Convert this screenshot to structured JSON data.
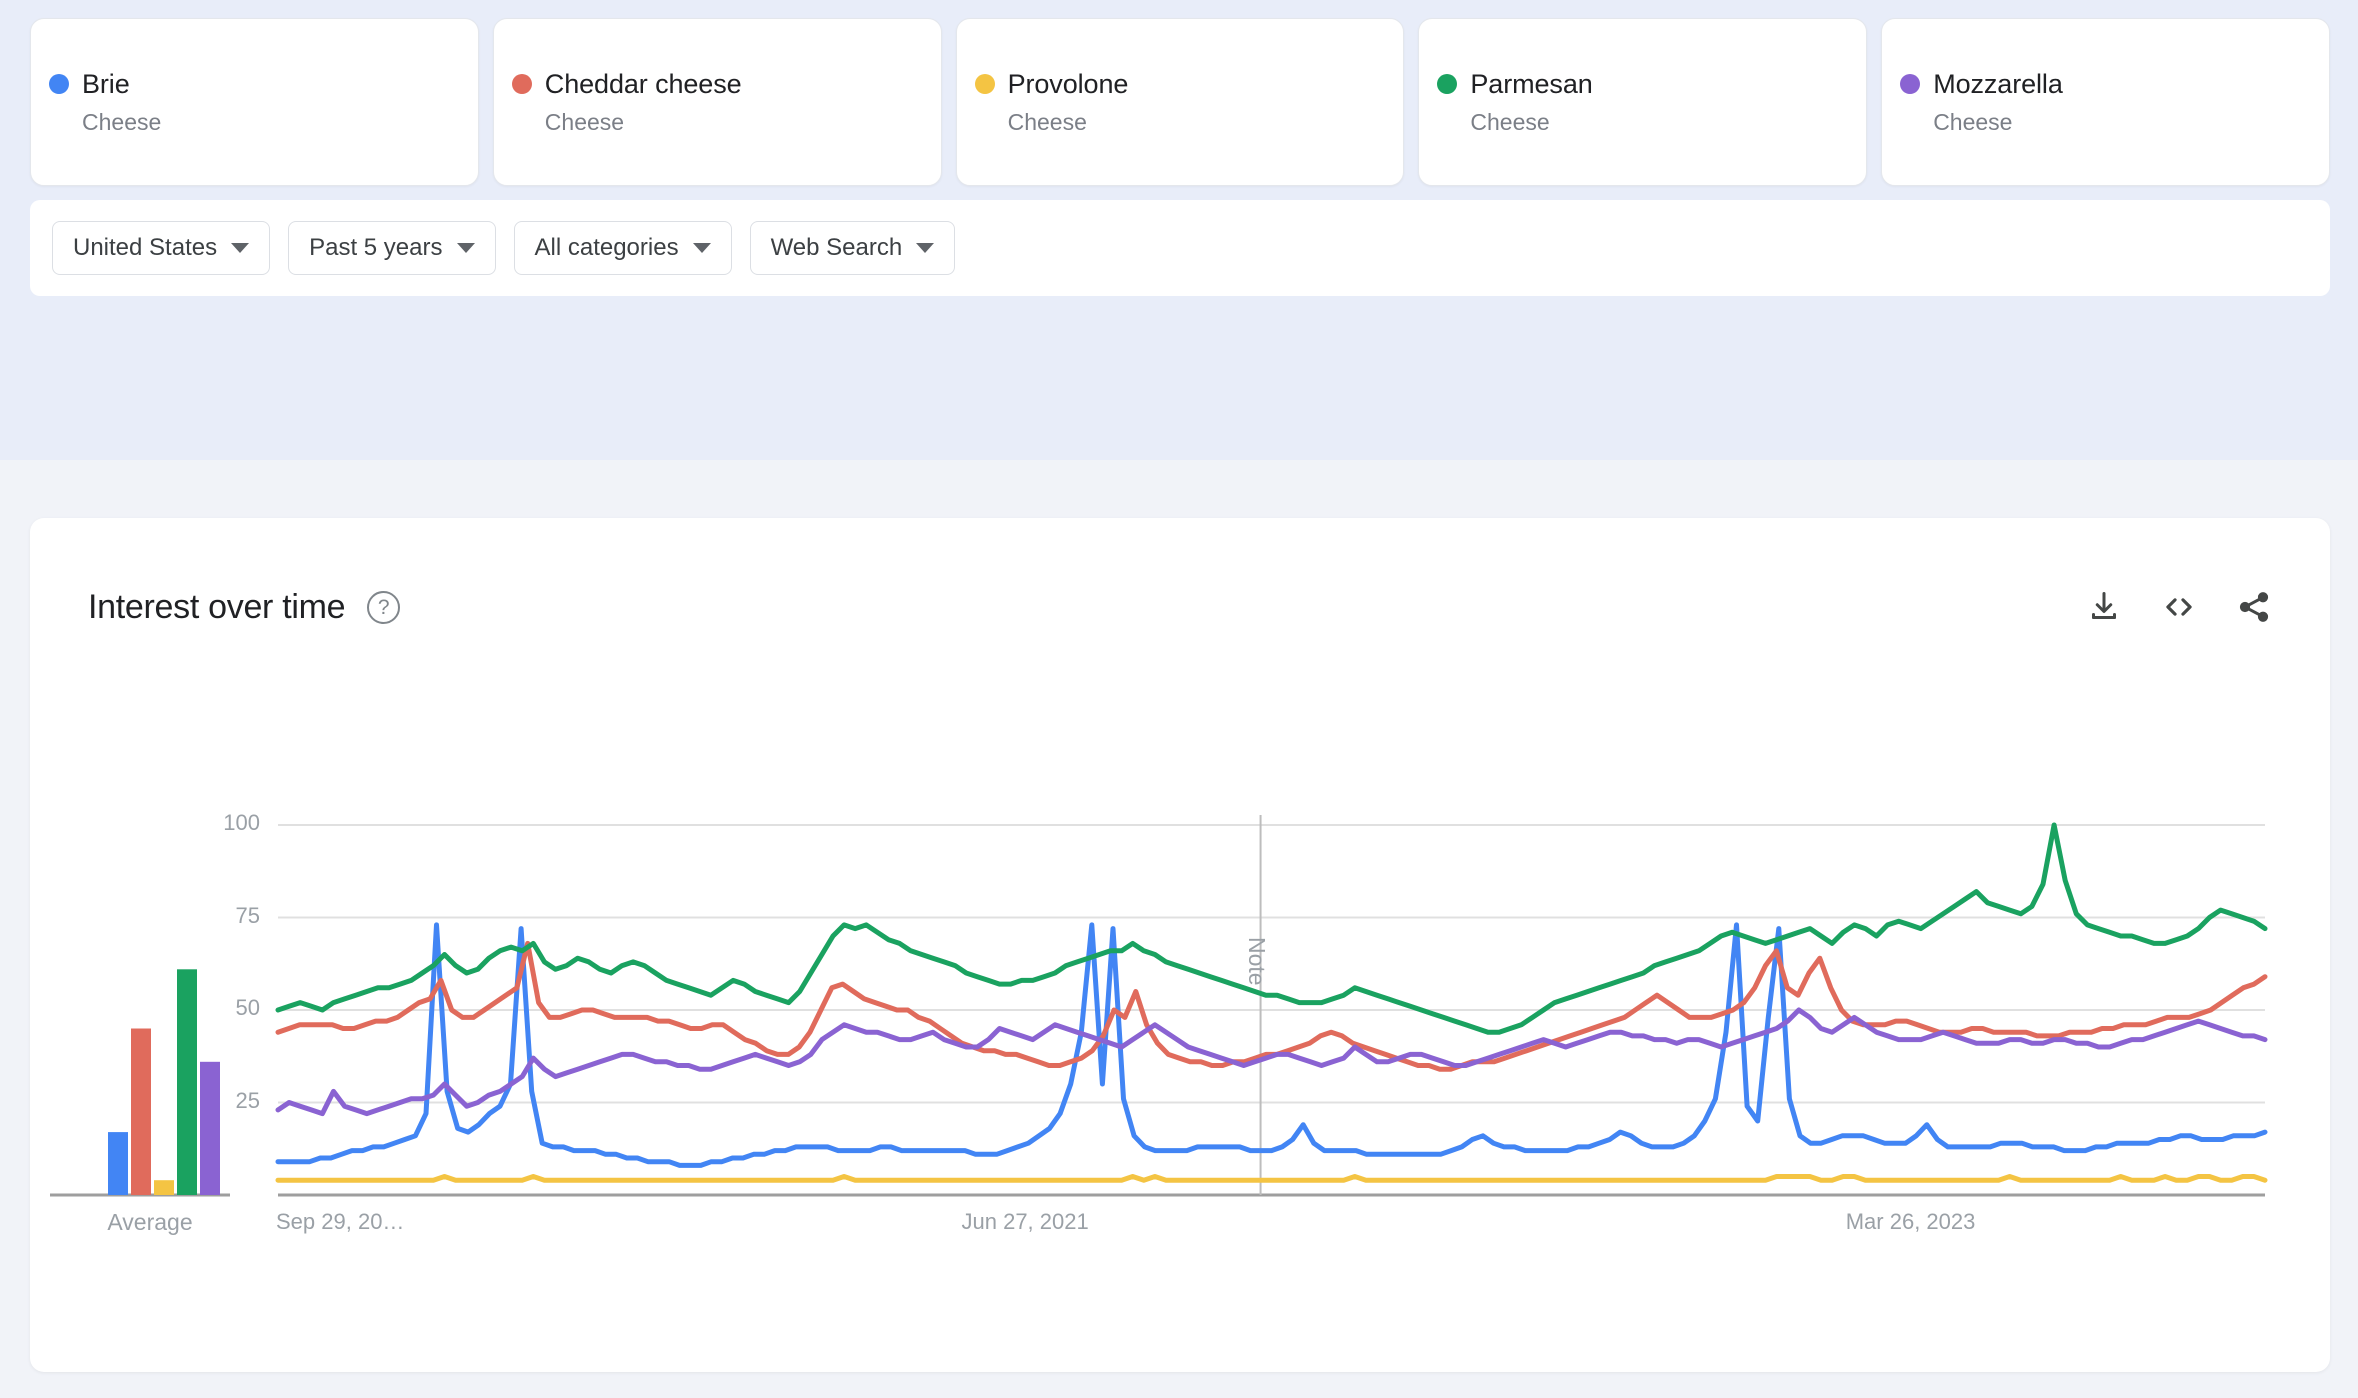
{
  "terms": [
    {
      "name": "Brie",
      "subtitle": "Cheese",
      "color": "#4285f4"
    },
    {
      "name": "Cheddar cheese",
      "subtitle": "Cheese",
      "color": "#e06b5c"
    },
    {
      "name": "Provolone",
      "subtitle": "Cheese",
      "color": "#f4c443"
    },
    {
      "name": "Parmesan",
      "subtitle": "Cheese",
      "color": "#1aa260"
    },
    {
      "name": "Mozzarella",
      "subtitle": "Cheese",
      "color": "#8a63d2"
    }
  ],
  "filters": [
    {
      "label": "United States",
      "icon": "chevron-down-icon"
    },
    {
      "label": "Past 5 years",
      "icon": "chevron-down-icon"
    },
    {
      "label": "All categories",
      "icon": "chevron-down-icon"
    },
    {
      "label": "Web Search",
      "icon": "chevron-down-icon"
    }
  ],
  "chart_card": {
    "title": "Interest over time",
    "help_icon": "help-circle-icon",
    "actions": [
      {
        "name": "download-icon"
      },
      {
        "name": "embed-code-icon"
      },
      {
        "name": "share-icon"
      }
    ]
  },
  "chart_data": {
    "type": "line",
    "title": "Interest over time",
    "xlabel": "",
    "ylabel": "",
    "ylim": [
      0,
      100
    ],
    "yticks": [
      25,
      50,
      75,
      100
    ],
    "grid": true,
    "legend_position": "top-cards",
    "x_tick_labels": [
      "Sep 29, 20…",
      "Jun 27, 2021",
      "Mar 26, 2023"
    ],
    "x_tick_positions": [
      0.0,
      0.345,
      0.79
    ],
    "annotations": [
      {
        "text": "Note",
        "type": "vertical-marker",
        "x_fraction": 0.4945
      }
    ],
    "average_bars": {
      "label": "Average",
      "categories": [
        "Brie",
        "Cheddar cheese",
        "Provolone",
        "Parmesan",
        "Mozzarella"
      ],
      "values": [
        17,
        45,
        4,
        61,
        36
      ]
    },
    "series": [
      {
        "name": "Brie",
        "color": "#4285f4",
        "values": [
          9,
          9,
          9,
          9,
          10,
          10,
          11,
          12,
          12,
          13,
          13,
          14,
          15,
          16,
          22,
          73,
          28,
          18,
          17,
          19,
          22,
          24,
          30,
          72,
          28,
          14,
          13,
          13,
          12,
          12,
          12,
          11,
          11,
          10,
          10,
          9,
          9,
          9,
          8,
          8,
          8,
          9,
          9,
          10,
          10,
          11,
          11,
          12,
          12,
          13,
          13,
          13,
          13,
          12,
          12,
          12,
          12,
          13,
          13,
          12,
          12,
          12,
          12,
          12,
          12,
          12,
          11,
          11,
          11,
          12,
          13,
          14,
          16,
          18,
          22,
          30,
          44,
          73,
          30,
          72,
          26,
          16,
          13,
          12,
          12,
          12,
          12,
          13,
          13,
          13,
          13,
          13,
          12,
          12,
          12,
          13,
          15,
          19,
          14,
          12,
          12,
          12,
          12,
          11,
          11,
          11,
          11,
          11,
          11,
          11,
          11,
          12,
          13,
          15,
          16,
          14,
          13,
          13,
          12,
          12,
          12,
          12,
          12,
          13,
          13,
          14,
          15,
          17,
          16,
          14,
          13,
          13,
          13,
          14,
          16,
          20,
          26,
          44,
          73,
          24,
          20,
          48,
          72,
          26,
          16,
          14,
          14,
          15,
          16,
          16,
          16,
          15,
          14,
          14,
          14,
          16,
          19,
          15,
          13,
          13,
          13,
          13,
          13,
          14,
          14,
          14,
          13,
          13,
          13,
          12,
          12,
          12,
          13,
          13,
          14,
          14,
          14,
          14,
          15,
          15,
          16,
          16,
          15,
          15,
          15,
          16,
          16,
          16,
          17
        ]
      },
      {
        "name": "Cheddar cheese",
        "color": "#e06b5c",
        "values": [
          44,
          45,
          46,
          46,
          46,
          46,
          45,
          45,
          46,
          47,
          47,
          48,
          50,
          52,
          53,
          58,
          50,
          48,
          48,
          50,
          52,
          54,
          56,
          68,
          52,
          48,
          48,
          49,
          50,
          50,
          49,
          48,
          48,
          48,
          48,
          47,
          47,
          46,
          45,
          45,
          46,
          46,
          44,
          42,
          41,
          39,
          38,
          38,
          40,
          44,
          50,
          56,
          57,
          55,
          53,
          52,
          51,
          50,
          50,
          48,
          47,
          45,
          43,
          41,
          40,
          39,
          39,
          38,
          38,
          37,
          36,
          35,
          35,
          36,
          37,
          39,
          43,
          50,
          48,
          55,
          46,
          41,
          38,
          37,
          36,
          36,
          35,
          35,
          36,
          36,
          37,
          38,
          38,
          39,
          40,
          41,
          43,
          44,
          43,
          41,
          40,
          39,
          38,
          37,
          36,
          35,
          35,
          34,
          34,
          35,
          36,
          36,
          36,
          37,
          38,
          39,
          40,
          41,
          42,
          43,
          44,
          45,
          46,
          47,
          48,
          50,
          52,
          54,
          52,
          50,
          48,
          48,
          48,
          49,
          50,
          52,
          56,
          62,
          66,
          56,
          54,
          60,
          64,
          56,
          50,
          47,
          46,
          46,
          46,
          47,
          47,
          46,
          45,
          44,
          44,
          44,
          45,
          45,
          44,
          44,
          44,
          44,
          43,
          43,
          43,
          44,
          44,
          44,
          45,
          45,
          46,
          46,
          46,
          47,
          48,
          48,
          48,
          49,
          50,
          52,
          54,
          56,
          57,
          59
        ]
      },
      {
        "name": "Provolone",
        "color": "#f4c443",
        "values": [
          4,
          4,
          4,
          4,
          4,
          4,
          4,
          4,
          4,
          4,
          4,
          4,
          4,
          4,
          4,
          5,
          4,
          4,
          4,
          4,
          4,
          4,
          4,
          5,
          4,
          4,
          4,
          4,
          4,
          4,
          4,
          4,
          4,
          4,
          4,
          4,
          4,
          4,
          4,
          4,
          4,
          4,
          4,
          4,
          4,
          4,
          4,
          4,
          4,
          4,
          4,
          5,
          4,
          4,
          4,
          4,
          4,
          4,
          4,
          4,
          4,
          4,
          4,
          4,
          4,
          4,
          4,
          4,
          4,
          4,
          4,
          4,
          4,
          4,
          4,
          4,
          4,
          5,
          4,
          5,
          4,
          4,
          4,
          4,
          4,
          4,
          4,
          4,
          4,
          4,
          4,
          4,
          4,
          4,
          4,
          4,
          4,
          5,
          4,
          4,
          4,
          4,
          4,
          4,
          4,
          4,
          4,
          4,
          4,
          4,
          4,
          4,
          4,
          4,
          4,
          4,
          4,
          4,
          4,
          4,
          4,
          4,
          4,
          4,
          4,
          4,
          4,
          4,
          4,
          4,
          4,
          4,
          4,
          4,
          4,
          5,
          5,
          5,
          5,
          4,
          4,
          5,
          5,
          4,
          4,
          4,
          4,
          4,
          4,
          4,
          4,
          4,
          4,
          4,
          4,
          4,
          5,
          4,
          4,
          4,
          4,
          4,
          4,
          4,
          4,
          4,
          5,
          4,
          4,
          4,
          5,
          4,
          4,
          5,
          5,
          4,
          4,
          5,
          5,
          4
        ]
      },
      {
        "name": "Parmesan",
        "color": "#1aa260",
        "values": [
          50,
          51,
          52,
          51,
          50,
          52,
          53,
          54,
          55,
          56,
          56,
          57,
          58,
          60,
          62,
          65,
          62,
          60,
          61,
          64,
          66,
          67,
          66,
          68,
          63,
          61,
          62,
          64,
          63,
          61,
          60,
          62,
          63,
          62,
          60,
          58,
          57,
          56,
          55,
          54,
          56,
          58,
          57,
          55,
          54,
          53,
          52,
          55,
          60,
          65,
          70,
          73,
          72,
          73,
          71,
          69,
          68,
          66,
          65,
          64,
          63,
          62,
          60,
          59,
          58,
          57,
          57,
          58,
          58,
          59,
          60,
          62,
          63,
          64,
          65,
          66,
          66,
          68,
          66,
          65,
          63,
          62,
          61,
          60,
          59,
          58,
          57,
          56,
          55,
          54,
          54,
          53,
          52,
          52,
          52,
          53,
          54,
          56,
          55,
          54,
          53,
          52,
          51,
          50,
          49,
          48,
          47,
          46,
          45,
          44,
          44,
          45,
          46,
          48,
          50,
          52,
          53,
          54,
          55,
          56,
          57,
          58,
          59,
          60,
          62,
          63,
          64,
          65,
          66,
          68,
          70,
          71,
          70,
          69,
          68,
          69,
          70,
          71,
          72,
          70,
          68,
          71,
          73,
          72,
          70,
          73,
          74,
          73,
          72,
          74,
          76,
          78,
          80,
          82,
          79,
          78,
          77,
          76,
          78,
          84,
          100,
          85,
          76,
          73,
          72,
          71,
          70,
          70,
          69,
          68,
          68,
          69,
          70,
          72,
          75,
          77,
          76,
          75,
          74,
          72
        ]
      },
      {
        "name": "Mozzarella",
        "color": "#8a63d2",
        "values": [
          23,
          25,
          24,
          23,
          22,
          28,
          24,
          23,
          22,
          23,
          24,
          25,
          26,
          26,
          27,
          30,
          27,
          24,
          25,
          27,
          28,
          30,
          32,
          37,
          34,
          32,
          33,
          34,
          35,
          36,
          37,
          38,
          38,
          37,
          36,
          36,
          35,
          35,
          34,
          34,
          35,
          36,
          37,
          38,
          37,
          36,
          35,
          36,
          38,
          42,
          44,
          46,
          45,
          44,
          44,
          43,
          42,
          42,
          43,
          44,
          42,
          41,
          40,
          40,
          42,
          45,
          44,
          43,
          42,
          44,
          46,
          45,
          44,
          43,
          42,
          41,
          40,
          42,
          44,
          46,
          44,
          42,
          40,
          39,
          38,
          37,
          36,
          35,
          36,
          37,
          38,
          38,
          37,
          36,
          35,
          36,
          37,
          40,
          38,
          36,
          36,
          37,
          38,
          38,
          37,
          36,
          35,
          35,
          36,
          37,
          38,
          39,
          40,
          41,
          42,
          41,
          40,
          41,
          42,
          43,
          44,
          44,
          43,
          43,
          42,
          42,
          41,
          42,
          42,
          41,
          40,
          41,
          42,
          43,
          44,
          45,
          47,
          50,
          48,
          45,
          44,
          46,
          48,
          46,
          44,
          43,
          42,
          42,
          42,
          43,
          44,
          43,
          42,
          41,
          41,
          41,
          42,
          42,
          41,
          41,
          42,
          42,
          41,
          41,
          40,
          40,
          41,
          42,
          42,
          43,
          44,
          45,
          46,
          47,
          46,
          45,
          44,
          43,
          43,
          42
        ]
      }
    ]
  }
}
